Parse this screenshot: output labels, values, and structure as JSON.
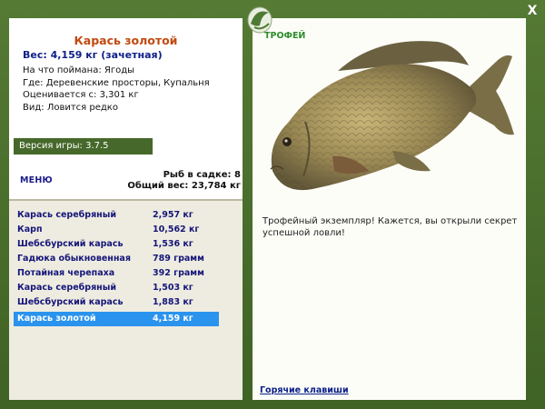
{
  "header": {
    "fish_name": "Карась золотой",
    "weight_line": "Вес: 4,159 кг (зачетная)",
    "close_glyph": "X"
  },
  "info": {
    "bait": "На что поймана: Ягоды",
    "location": "Где: Деревенские просторы, Купальня",
    "value": "Оценивается с: 3,301 кг",
    "rarity": "Вид: Ловится редко"
  },
  "version": "Версия игры: 3.7.5",
  "menu_label": "МЕНЮ",
  "stats": {
    "fish_in_keepnet": "Рыб в садке: 8",
    "total_weight": "Общий вес: 23,784 кг"
  },
  "catch_list": [
    {
      "name": "Карась серебряный",
      "weight": "2,957 кг"
    },
    {
      "name": "Карп",
      "weight": "10,562 кг"
    },
    {
      "name": "Шебсбурский карась",
      "weight": "1,536 кг"
    },
    {
      "name": "Гадюка обыкновенная",
      "weight": "789 грамм"
    },
    {
      "name": "Потайная черепаха",
      "weight": "392 грамм"
    },
    {
      "name": "Карась серебряный",
      "weight": "1,503 кг"
    },
    {
      "name": "Шебсбурский карась",
      "weight": "1,883 кг"
    },
    {
      "name": "Карась золотой",
      "weight": "4,159 кг"
    }
  ],
  "selected_index": 7,
  "trophy": {
    "label": "ТРОФЕЙ",
    "text": "Трофейный экземпляр! Кажется, вы открыли секрет успешной ловли!"
  },
  "hotkeys_link": "Горячие клавиши",
  "colors": {
    "frame_green": "#46692b",
    "title_orange": "#c04a10",
    "weight_blue": "#0e1f88",
    "selected_blue": "#2a93ee",
    "trophy_green": "#2e8c2c"
  },
  "icons": {
    "emblem": "fish-emblem-icon",
    "close": "close-icon",
    "trophy_fish": "crucian-carp-image"
  }
}
